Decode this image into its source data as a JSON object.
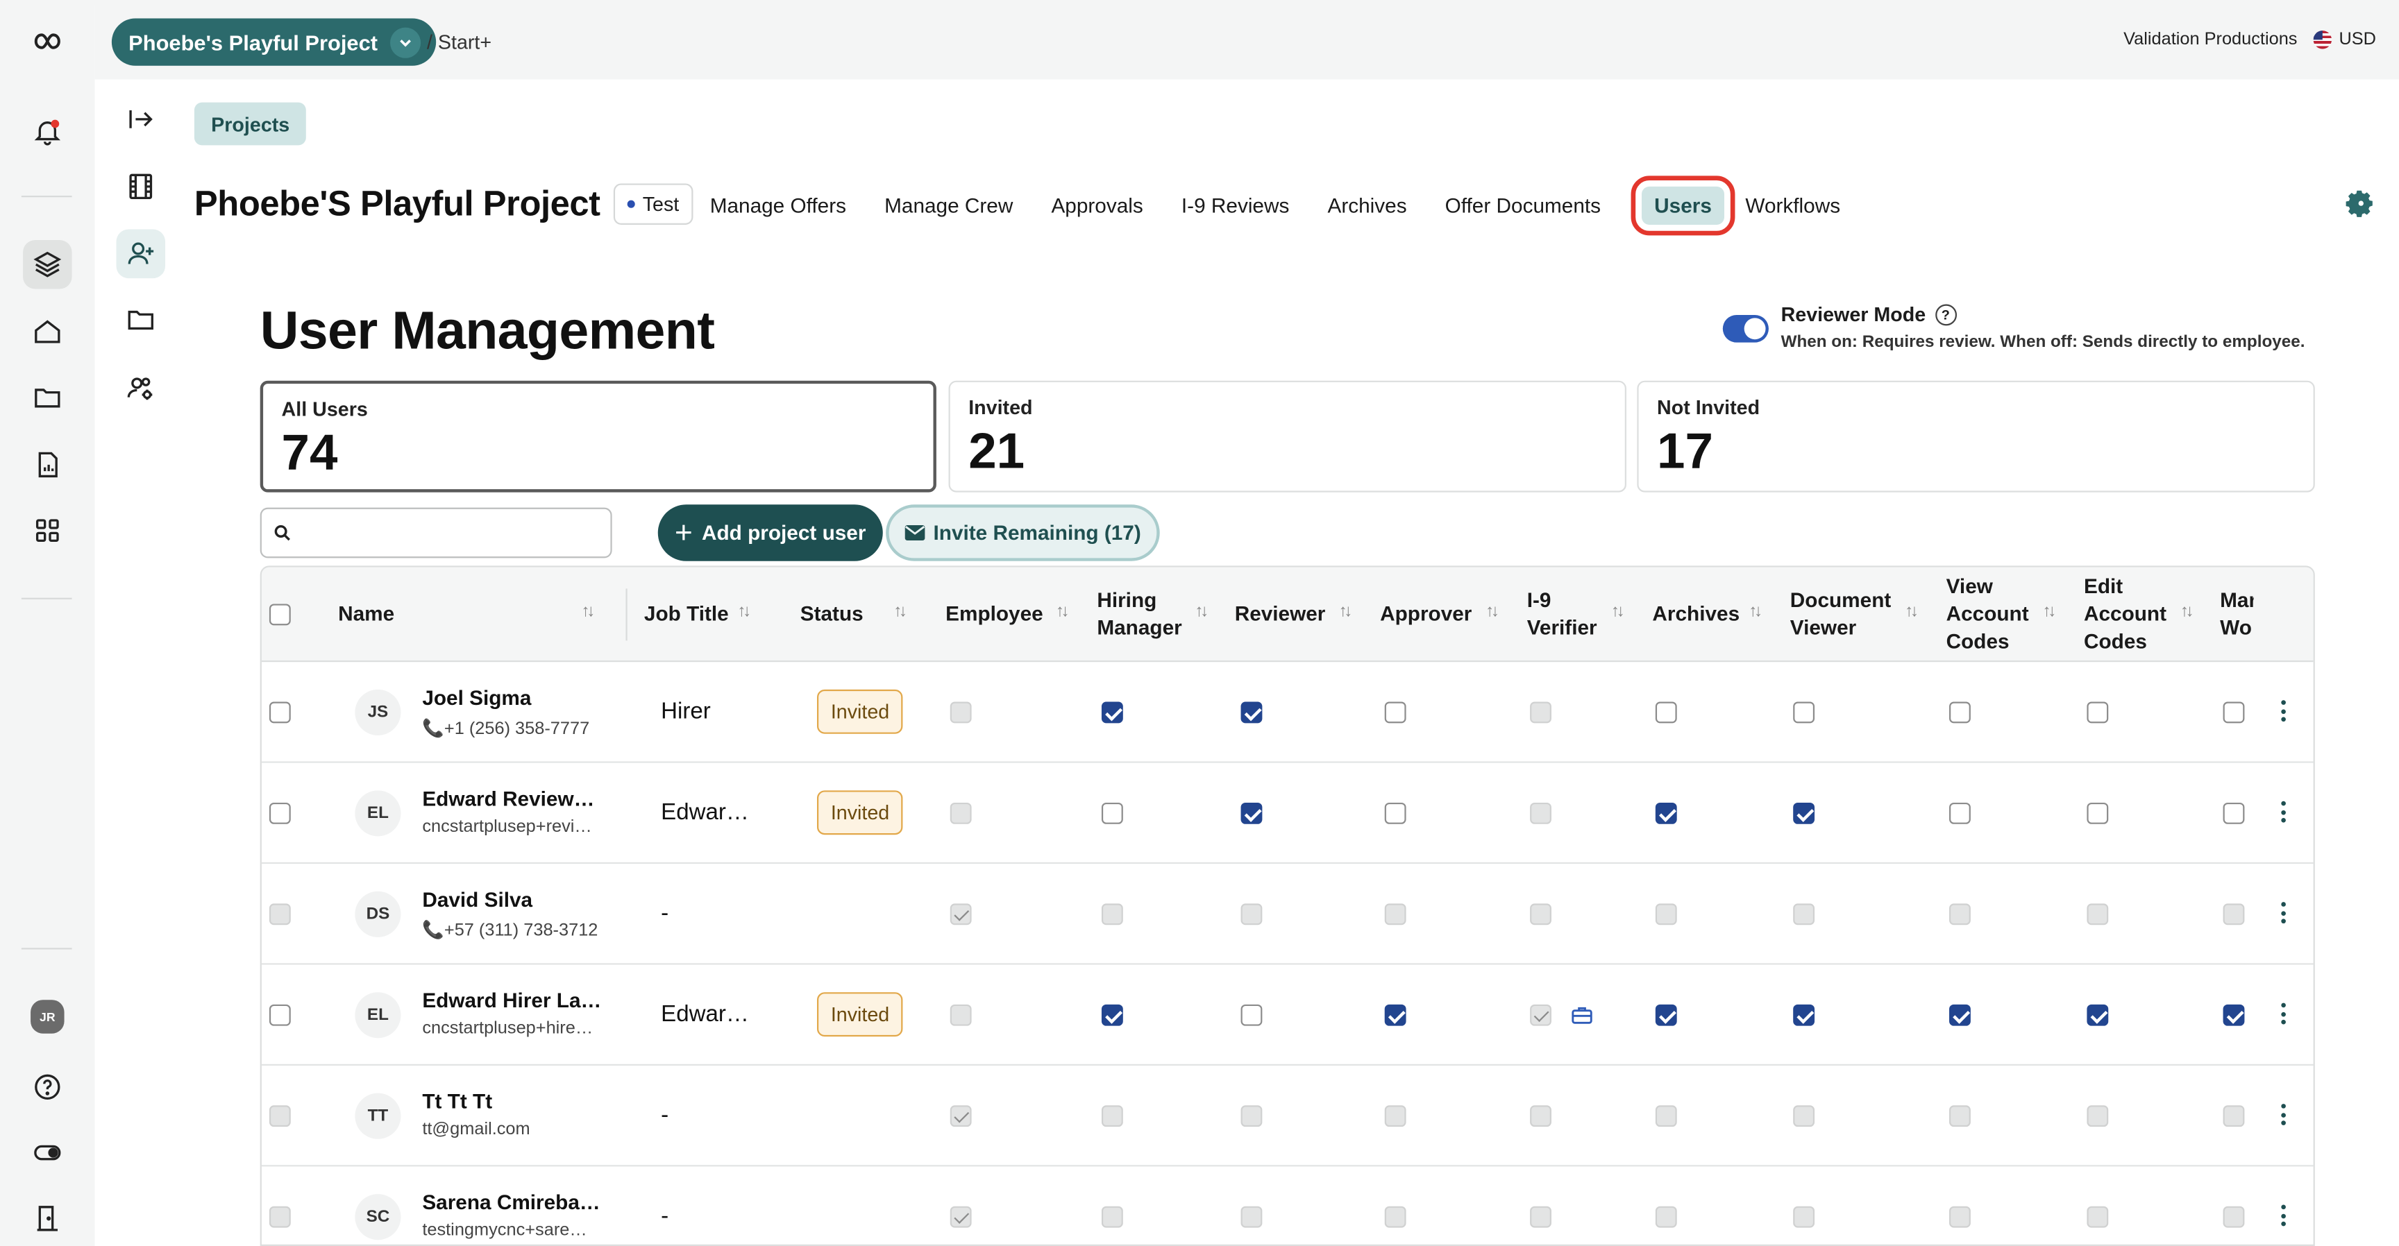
{
  "topbar": {
    "project_pill": "Phoebe's Playful Project",
    "breadcrumb": "/ Start+",
    "company": "Validation Productions",
    "currency": "USD"
  },
  "sidebar_inner": {
    "projects_tag": "Projects"
  },
  "project": {
    "title": "Phoebe'S Playful Project",
    "badge": "Test",
    "tabs": [
      "Manage Offers",
      "Manage Crew",
      "Approvals",
      "I-9 Reviews",
      "Archives",
      "Offer Documents",
      "Users",
      "Workflows"
    ],
    "active_tab": "Users"
  },
  "page": {
    "heading": "User Management",
    "reviewer_mode": {
      "label": "Reviewer Mode",
      "help": "?",
      "description": "When on: Requires review. When off: Sends directly to employee.",
      "enabled": true
    }
  },
  "stats": [
    {
      "label": "All Users",
      "value": "74"
    },
    {
      "label": "Invited",
      "value": "21"
    },
    {
      "label": "Not Invited",
      "value": "17"
    }
  ],
  "toolbar": {
    "search_placeholder": "",
    "add_button": "Add project user",
    "add_plus": "+",
    "invite_button": "Invite Remaining (17)"
  },
  "table": {
    "headers": {
      "name": "Name",
      "job_title": "Job Title",
      "status": "Status",
      "employee": "Employee",
      "hiring_manager": [
        "Hiring",
        "Manager"
      ],
      "reviewer": "Reviewer",
      "approver": "Approver",
      "i9_verifier": [
        "I-9",
        "Verifier"
      ],
      "archives": "Archives",
      "document_viewer": [
        "Document",
        "Viewer"
      ],
      "view_account_codes": [
        "View",
        "Account",
        "Codes"
      ],
      "edit_account_codes": [
        "Edit",
        "Account",
        "Codes"
      ],
      "manage_workflows": [
        "Mar",
        "Wo"
      ]
    },
    "rows": [
      {
        "initials": "JS",
        "name": "Joel Sigma",
        "contact": "📞+1 (256) 358-7777",
        "job": "Hirer",
        "status": "Invited",
        "perms": [
          "dis",
          "on",
          "on",
          "off",
          "dis",
          "off",
          "off",
          "off",
          "off",
          "off"
        ]
      },
      {
        "initials": "EL",
        "name": "Edward Review…",
        "contact": "cncstartplusep+revi…",
        "job": "Edwar…",
        "status": "Invited",
        "perms": [
          "dis",
          "off",
          "on",
          "off",
          "dis",
          "on",
          "on",
          "off",
          "off",
          "off"
        ]
      },
      {
        "initials": "DS",
        "name": "David Silva",
        "contact": "📞+57 (311) 738-3712",
        "job": "-",
        "status": "",
        "perms": [
          "dison",
          "dis",
          "dis",
          "dis",
          "dis",
          "dis",
          "dis",
          "dis",
          "dis",
          "dis"
        ]
      },
      {
        "initials": "EL",
        "name": "Edward Hirer La…",
        "contact": "cncstartplusep+hire…",
        "job": "Edwar…",
        "status": "Invited",
        "perms": [
          "dis",
          "on",
          "off",
          "on",
          "dison",
          "on",
          "on",
          "on",
          "on",
          "on"
        ]
      },
      {
        "initials": "TT",
        "name": "Tt Tt Tt",
        "contact": "tt@gmail.com",
        "job": "-",
        "status": "",
        "perms": [
          "dison",
          "dis",
          "dis",
          "dis",
          "dis",
          "dis",
          "dis",
          "dis",
          "dis",
          "dis"
        ]
      },
      {
        "initials": "SC",
        "name": "Sarena Cmireba…",
        "contact": "testingmycnc+sare…",
        "job": "-",
        "status": "",
        "perms": [
          "dison",
          "dis",
          "dis",
          "dis",
          "dis",
          "dis",
          "dis",
          "dis",
          "dis",
          "dis"
        ]
      }
    ]
  },
  "colors": {
    "brand": "#1e4f51",
    "accent_blue": "#22458f",
    "highlight": "#e3372d"
  }
}
